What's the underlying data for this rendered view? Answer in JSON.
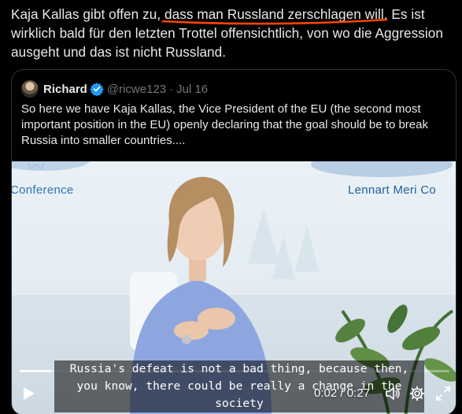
{
  "post": {
    "text_before": "Kaja Kallas gibt offen zu, ",
    "text_highlight": "dass man Russland zerschlagen will",
    "text_after": ". Es ist wirklich bald für den letzten Trottel offensichtlich, von wo die Aggression ausgeht und das ist nicht Russland."
  },
  "quote": {
    "name": "Richard",
    "handle": "@ricwe123",
    "separator": "·",
    "date": "Jul 16",
    "text": "So here we have Kaja Kallas, the Vice President of the EU (the second most important position in the EU) openly declaring that the goal should be to break Russia into smaller countries...."
  },
  "video": {
    "banner_left": "Conference",
    "banner_right": "Lennart Meri Co",
    "subtitle": "Russia's defeat is not a bad thing, because then, you know, there could be really a change in the society",
    "current_time": "0:02",
    "time_separator": " / ",
    "duration": "0:27",
    "progress": 0.074
  },
  "icons": {
    "play": "play-icon",
    "volume": "volume-icon",
    "settings": "gear-icon",
    "fullscreen": "fullscreen-icon",
    "verified": "verified-badge-icon"
  },
  "colors": {
    "background": "#000000",
    "text": "#e7e9ea",
    "muted": "#71767b",
    "verified": "#1d9bf0",
    "annotation": "#ff4500"
  }
}
